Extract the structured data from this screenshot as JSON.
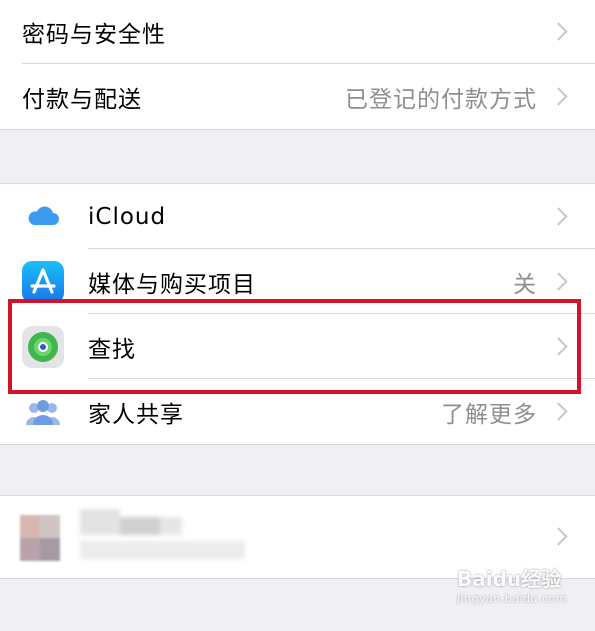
{
  "account_group": [
    {
      "label": "密码与安全性",
      "detail": ""
    },
    {
      "label": "付款与配送",
      "detail": "已登记的付款方式"
    }
  ],
  "services_group": [
    {
      "icon": "icloud-icon",
      "label": "iCloud",
      "detail": ""
    },
    {
      "icon": "app-store-icon",
      "label": "媒体与购买项目",
      "detail": "关"
    },
    {
      "icon": "find-my-icon",
      "label": "查找",
      "detail": ""
    },
    {
      "icon": "family-sharing-icon",
      "label": "家人共享",
      "detail": "了解更多"
    }
  ],
  "watermark": {
    "main": "Baidu经验",
    "sub": "jingyan.baidu.com"
  },
  "colors": {
    "highlight_border": "#d2142a",
    "background": "#efeff4",
    "detail_text": "#8e8e93",
    "chevron": "#c7c7cc"
  }
}
